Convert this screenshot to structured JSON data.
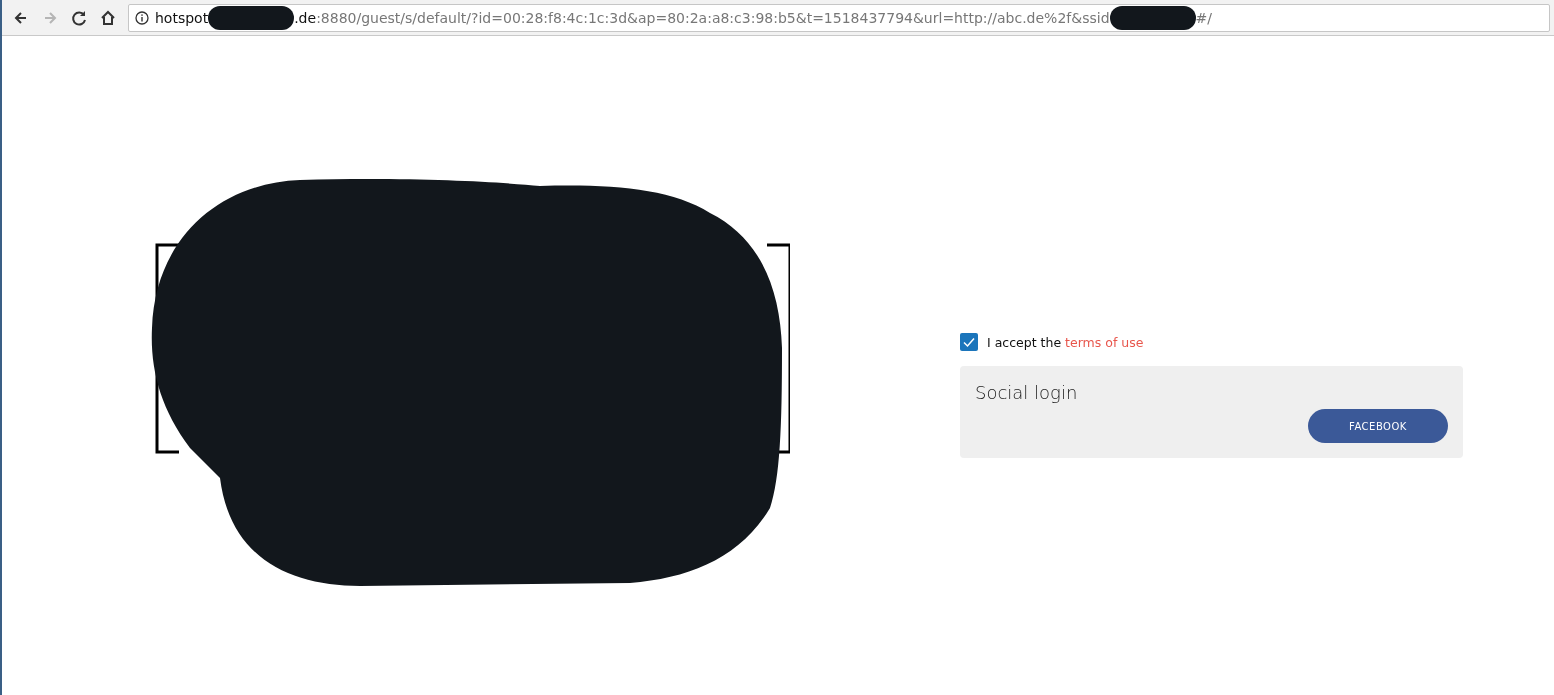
{
  "browser": {
    "nav": [
      {
        "kind": "back",
        "disabled": false
      },
      {
        "kind": "forward",
        "disabled": true
      },
      {
        "kind": "reload",
        "disabled": false
      },
      {
        "kind": "home",
        "disabled": false
      }
    ],
    "url": [
      {
        "kind": "host",
        "text": "hotspot"
      },
      {
        "kind": "redacted"
      },
      {
        "kind": "host",
        "text": ".de"
      },
      {
        "kind": "path",
        "text": ":8880/guest/s/default/?id=00:28:f8:4c:1c:3d&ap=80:2a:a8:c3:98:b5&t=1518437794&url=http://abc.de%2f&ssid"
      },
      {
        "kind": "redacted"
      },
      {
        "kind": "path",
        "text": "#/"
      }
    ]
  },
  "terms": {
    "checked": true,
    "text": "I accept the",
    "link": "terms of use"
  },
  "social": {
    "title": "Social login",
    "buttons": [
      "FACEBOOK"
    ]
  }
}
